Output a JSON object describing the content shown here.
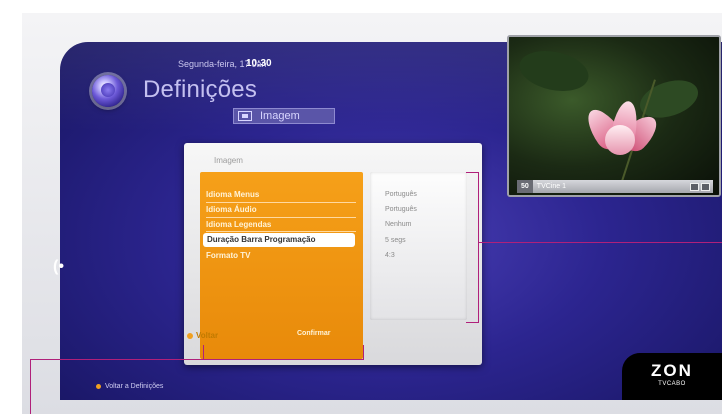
{
  "header": {
    "date": "Segunda-feira, 17 Jan",
    "time": "10:30",
    "title": "Definições",
    "section_badge": "Imagem"
  },
  "panel": {
    "title": "Imagem",
    "menu_items": [
      {
        "label": "Idioma Menus",
        "value": "Português"
      },
      {
        "label": "Idioma Áudio",
        "value": "Português"
      },
      {
        "label": "Idioma Legendas",
        "value": "Nenhum"
      },
      {
        "label": "Duração Barra Programação",
        "value": "5 segs"
      },
      {
        "label": "Formato TV",
        "value": "4:3"
      }
    ],
    "selected_index": 3,
    "back_label": "Voltar",
    "confirm_label": "Confirmar"
  },
  "preview": {
    "channel_number": "50",
    "channel_name": "TVCine 1"
  },
  "footer": {
    "back_text": "Voltar a Definições"
  },
  "brand": {
    "name": "ZON",
    "sub": "TVCABO"
  },
  "colors": {
    "accent_orange": "#f6a019",
    "background_blue": "#2c2590",
    "callout_magenta": "#b0207a"
  },
  "icons": {
    "app_logo": "definitions-orb-icon",
    "badge": "picture-icon",
    "side_nav": "remote-signal-icon"
  }
}
